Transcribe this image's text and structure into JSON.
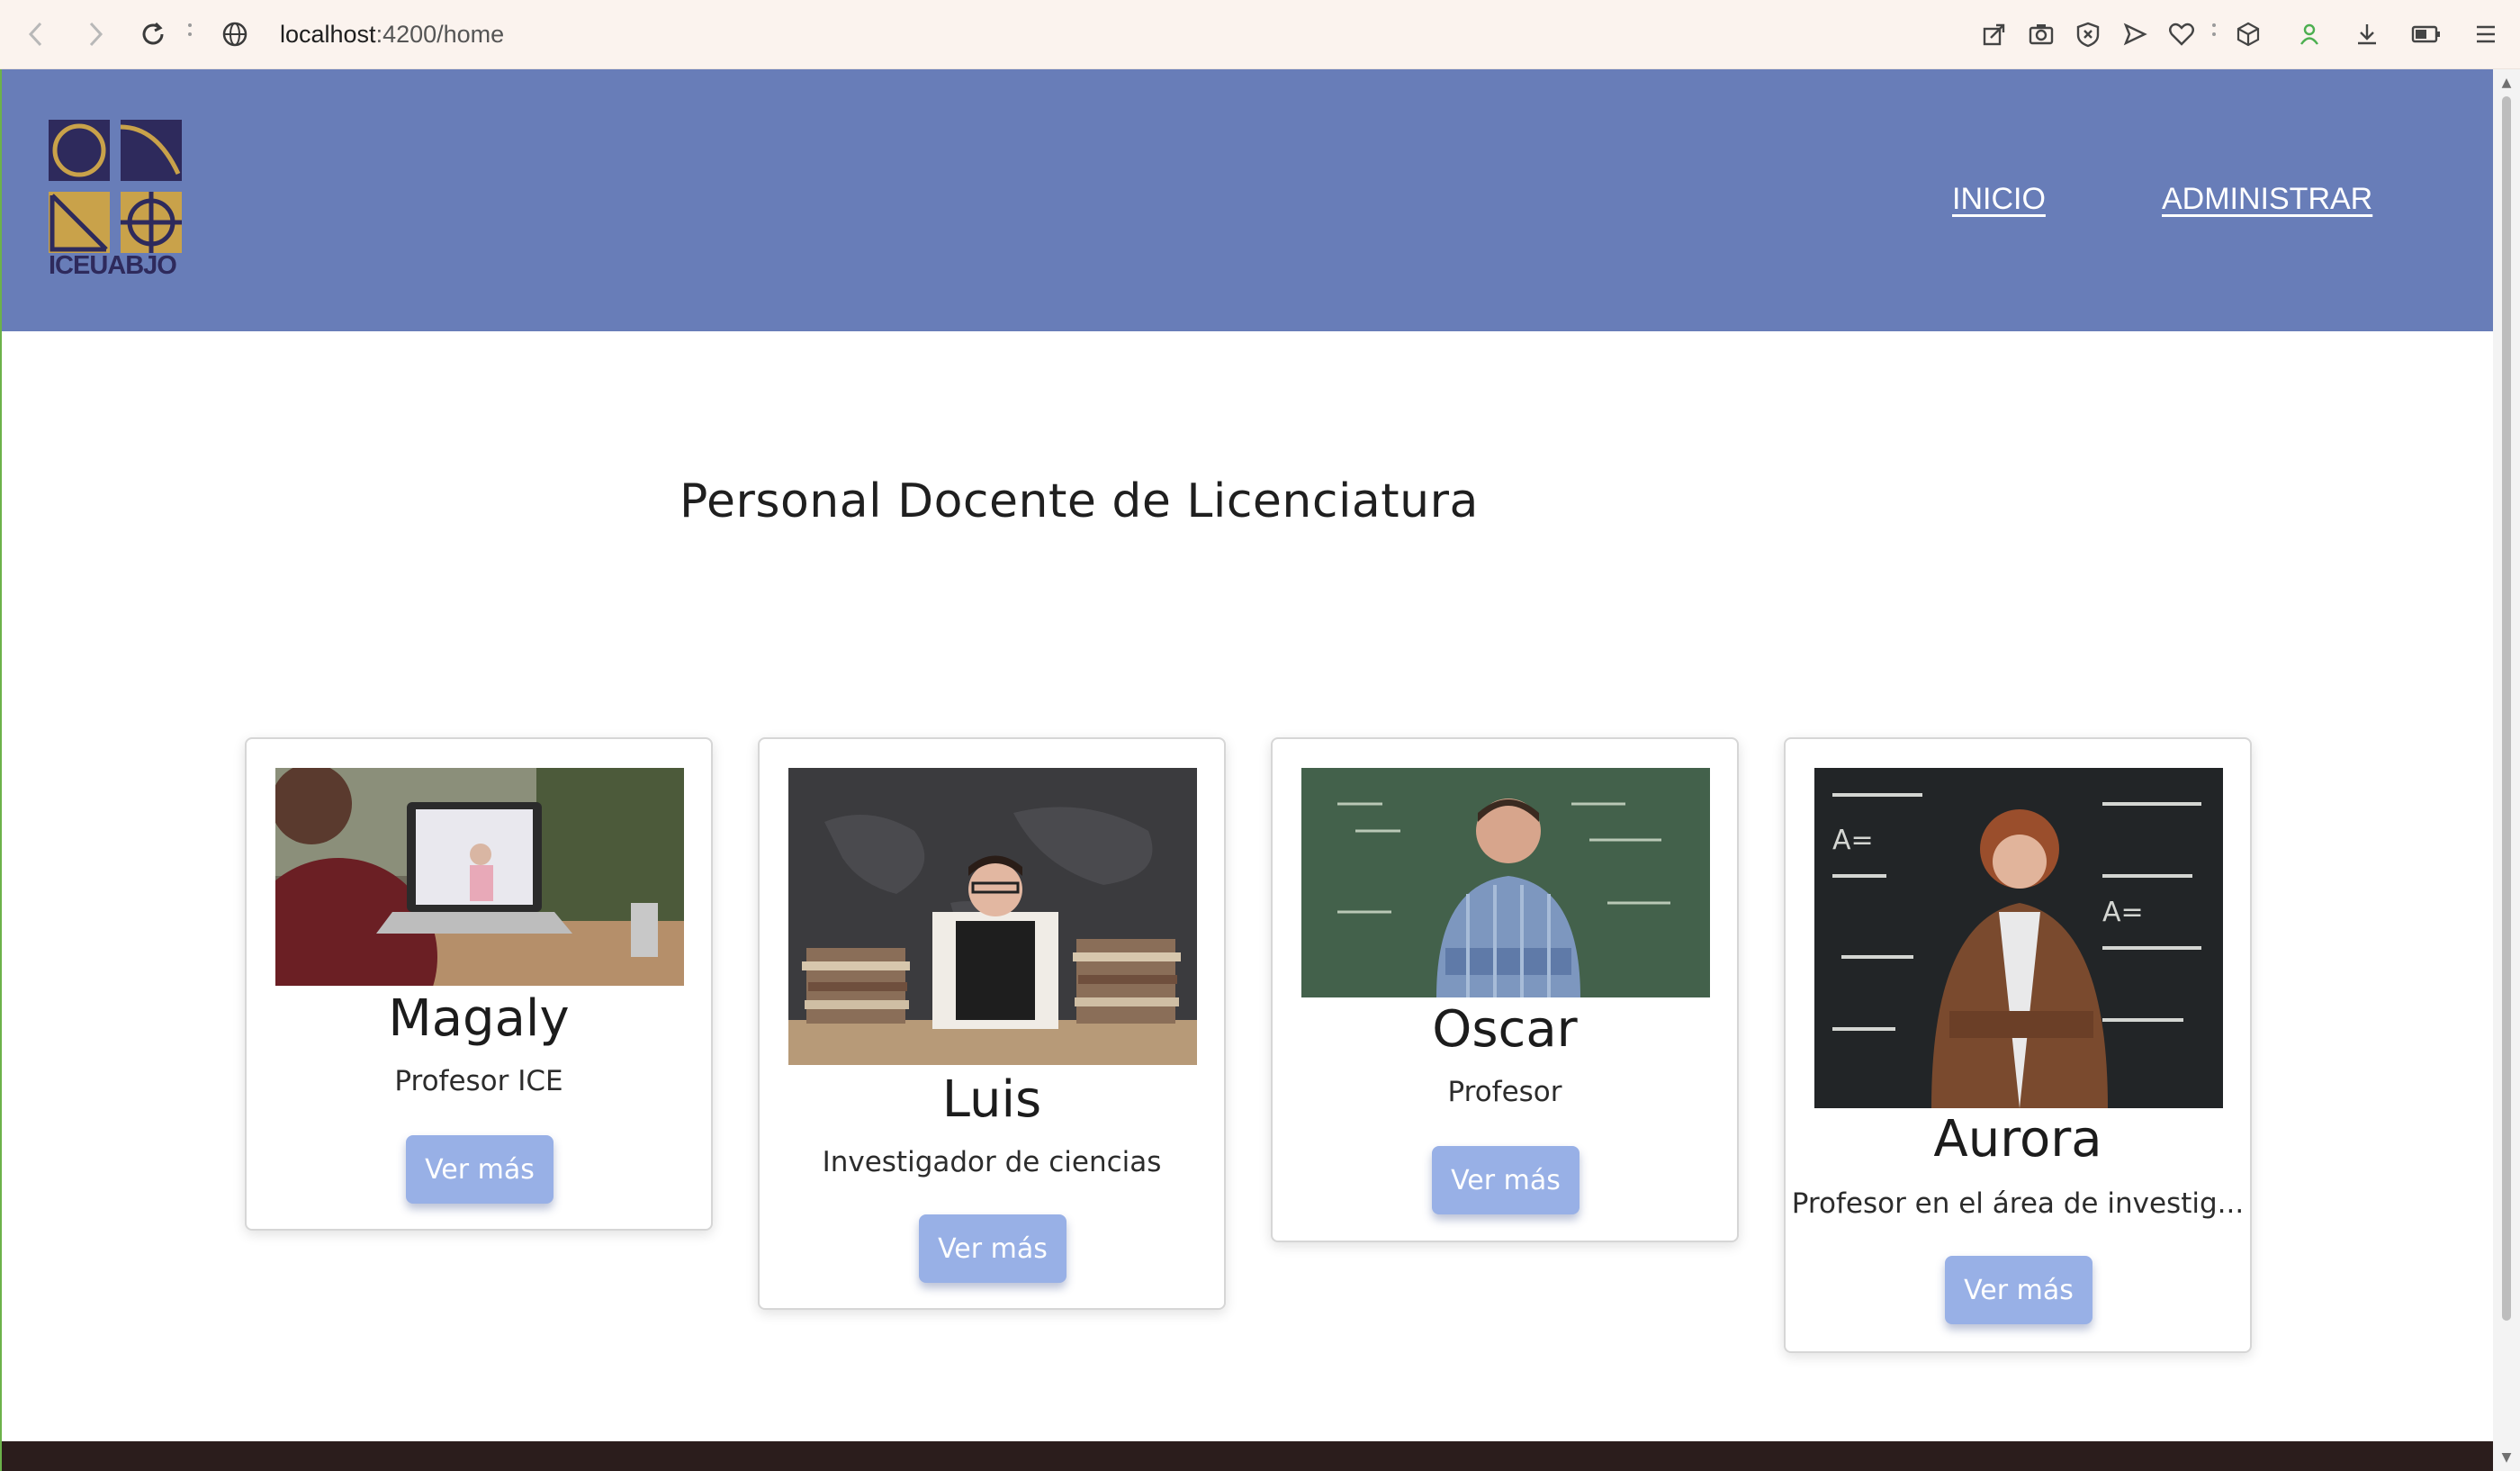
{
  "browser": {
    "url_host": "localhost",
    "url_rest": ":4200/home"
  },
  "header": {
    "logo_text": "ICEUABJO",
    "nav": [
      {
        "label": "INICIO"
      },
      {
        "label": "ADMINISTRAR"
      }
    ]
  },
  "main": {
    "title": "Personal Docente de Licenciatura",
    "cards": [
      {
        "name": "Magaly",
        "role": "Profesor ICE",
        "button": "Ver más"
      },
      {
        "name": "Luis",
        "role": "Investigador de ciencias",
        "button": "Ver más"
      },
      {
        "name": "Oscar",
        "role": "Profesor",
        "button": "Ver más"
      },
      {
        "name": "Aurora",
        "role": "Profesor en el área de investig...",
        "button": "Ver más"
      }
    ]
  },
  "colors": {
    "header_bg": "#687db8",
    "button_bg": "#98b0e6",
    "logo_navy": "#2e2a5c",
    "logo_gold": "#c9a24a",
    "footer_bg": "#2b1d1c"
  }
}
